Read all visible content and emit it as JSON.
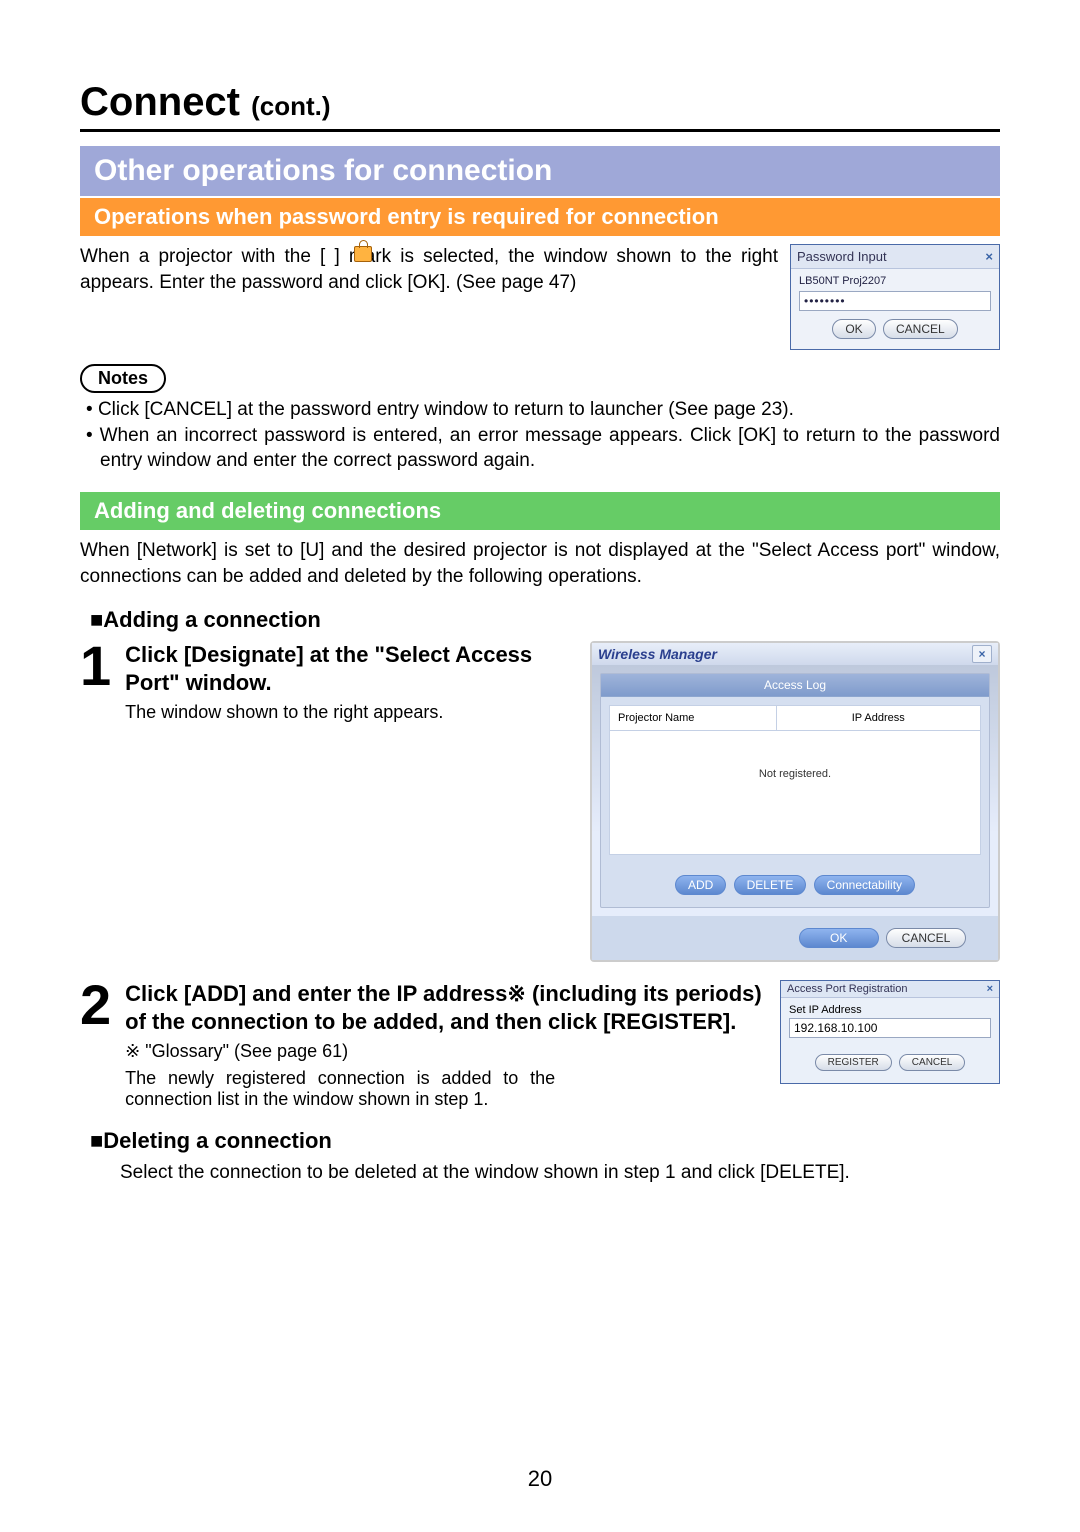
{
  "page": {
    "title_main": "Connect",
    "title_cont": "(cont.)",
    "number": "20"
  },
  "banner_main": "Other operations for connection",
  "section_password": {
    "heading": "Operations when password entry is required for connection",
    "para": "When a projector with the [   ] mark is selected, the window shown to the right appears. Enter the password and click [OK]. (See page 47)",
    "notes_label": "Notes",
    "notes": [
      "Click [CANCEL] at the password entry window to return to launcher (See page 23).",
      "When an incorrect password is entered, an error message appears. Click [OK] to return to the password entry window and enter the correct password again."
    ]
  },
  "password_dialog": {
    "title": "Password Input",
    "device": "LB50NT  Proj2207",
    "value": "••••••••",
    "ok": "OK",
    "cancel": "CANCEL"
  },
  "section_adddel": {
    "heading": "Adding and deleting connections",
    "intro": "When [Network] is set to [U] and the desired projector is not displayed at the \"Select Access port\" window, connections can be added and deleted by the following operations.",
    "adding_heading": "■Adding a connection",
    "step1": {
      "num": "1",
      "title": "Click [Designate] at the \"Select Access Port\" window.",
      "sub": "The window shown to the right appears."
    },
    "step2": {
      "num": "2",
      "title": "Click [ADD] and enter the IP address※ (including its periods) of the connection to be added, and then click [REGISTER].",
      "sub1": "※ \"Glossary\" (See page 61)",
      "sub2": "The newly registered connection is added to the connection list in the window shown in step 1."
    },
    "deleting_heading": "■Deleting a connection",
    "deleting_body": "Select the connection to be deleted at the window shown in step 1 and click [DELETE]."
  },
  "wm_dialog": {
    "title": "Wireless Manager",
    "tab": "Access Log",
    "col1": "Projector Name",
    "col2": "IP Address",
    "empty": "Not registered.",
    "add": "ADD",
    "delete": "DELETE",
    "connectability": "Connectability",
    "ok": "OK",
    "cancel": "CANCEL"
  },
  "apr_dialog": {
    "title": "Access Port Registration",
    "label": "Set IP Address",
    "value": "192.168.10.100",
    "register": "REGISTER",
    "cancel": "CANCEL"
  }
}
